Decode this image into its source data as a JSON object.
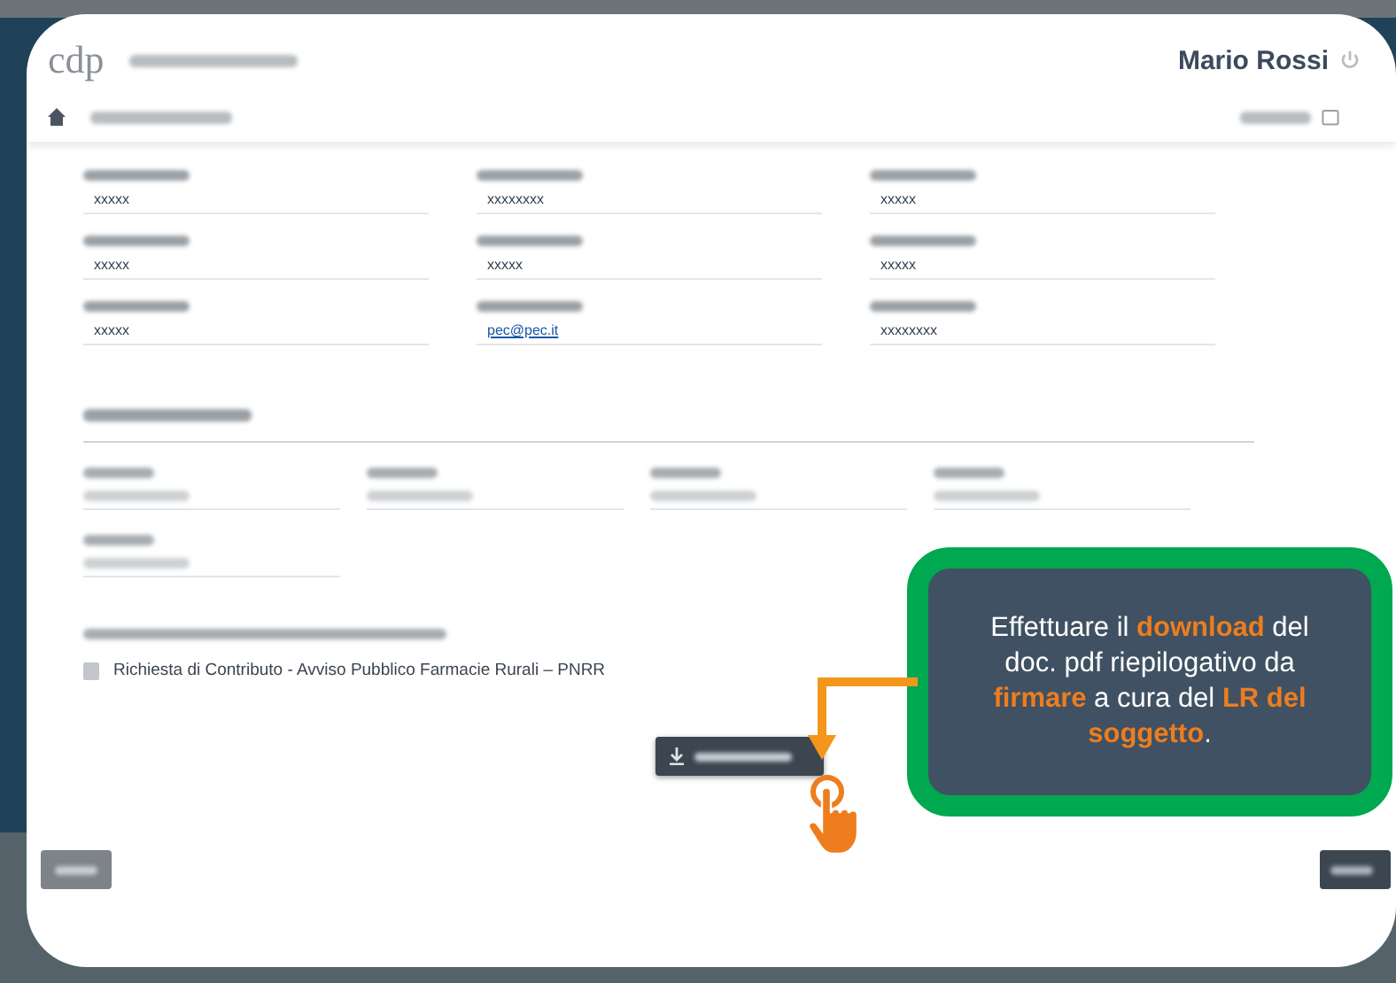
{
  "header": {
    "logo": "cdp",
    "user": "Mario Rossi"
  },
  "fields": [
    {
      "kind": "text",
      "value": "xxxxx"
    },
    {
      "kind": "text",
      "value": "xxxxxxxx"
    },
    {
      "kind": "text",
      "value": "xxxxx"
    },
    {
      "kind": "text",
      "value": "xxxxx"
    },
    {
      "kind": "text",
      "value": "xxxxx"
    },
    {
      "kind": "text",
      "value": "xxxxx"
    },
    {
      "kind": "text",
      "value": "xxxxx"
    },
    {
      "kind": "link",
      "value": "pec@pec.it"
    },
    {
      "kind": "text",
      "value": "xxxxxxxx"
    }
  ],
  "document": {
    "title": "Richiesta di Contributo - Avviso Pubblico Farmacie Rurali – PNRR"
  },
  "callout": {
    "text": "Effettuare il **download** del doc. pdf riepilogativo da **firmare** a cura del **LR del soggetto**."
  }
}
